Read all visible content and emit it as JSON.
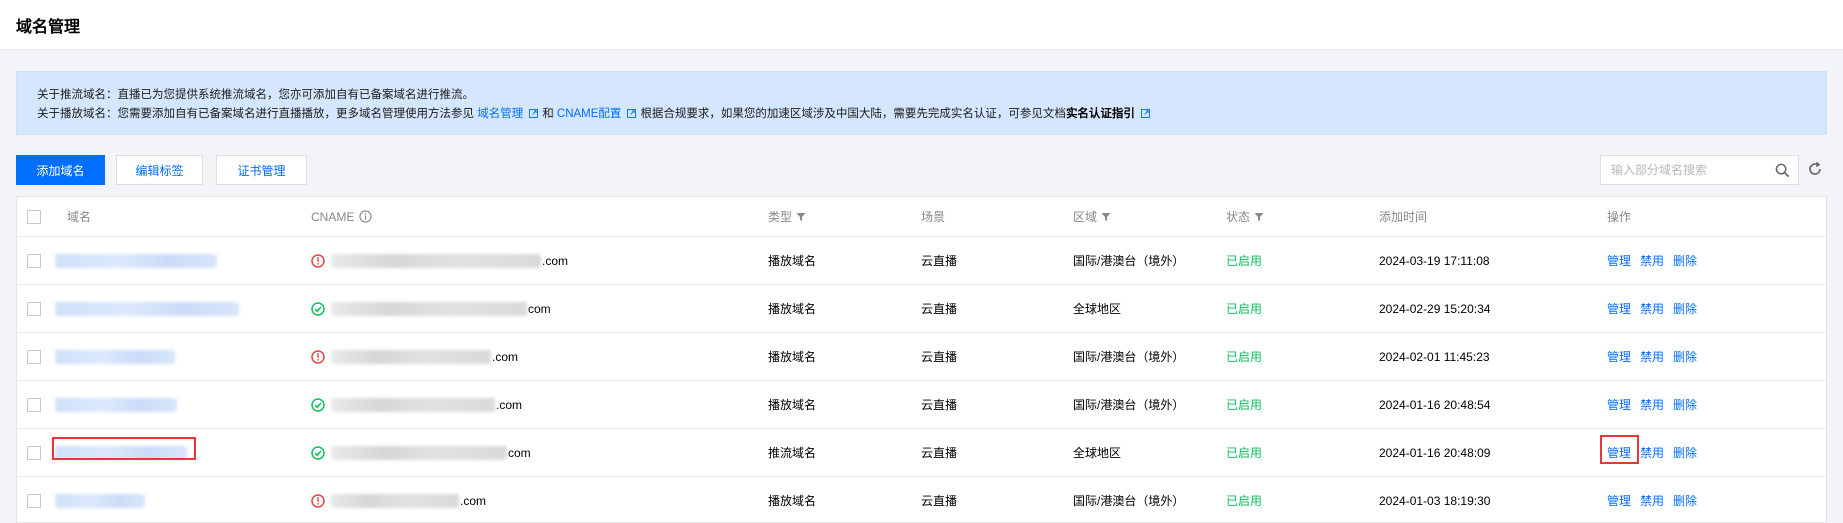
{
  "page": {
    "title": "域名管理"
  },
  "notice": {
    "line1": "关于推流域名：直播已为您提供系统推流域名，您亦可添加自有已备案域名进行推流。",
    "line2_prefix": "关于播放域名：您需要添加自有已备案域名进行直播播放，更多域名管理使用方法参见",
    "link_domain_mgmt": "域名管理",
    "and": "和",
    "link_cname": "CNAME配置",
    "line2_middle": "根据合规要求，如果您的加速区域涉及中国大陆，需要先完成实名认证，可参见文档",
    "link_realname": "实名认证指引"
  },
  "toolbar": {
    "add_domain": "添加域名",
    "edit_tags": "编辑标签",
    "cert_mgmt": "证书管理",
    "search_placeholder": "输入部分域名搜索"
  },
  "table": {
    "headers": {
      "domain": "域名",
      "cname": "CNAME",
      "type": "类型",
      "scene": "场景",
      "region": "区域",
      "status": "状态",
      "added": "添加时间",
      "ops": "操作"
    },
    "rows": [
      {
        "cname_status": "warning",
        "cname_suffix": ".com",
        "type": "播放域名",
        "scene": "云直播",
        "region": "国际/港澳台（境外）",
        "status": "已启用",
        "added": "2024-03-19 17:11:08",
        "op_manage": "管理",
        "op_disable": "禁用",
        "op_delete": "删除"
      },
      {
        "cname_status": "ok",
        "cname_suffix": "com",
        "type": "播放域名",
        "scene": "云直播",
        "region": "全球地区",
        "status": "已启用",
        "added": "2024-02-29 15:20:34",
        "op_manage": "管理",
        "op_disable": "禁用",
        "op_delete": "删除"
      },
      {
        "cname_status": "warning",
        "cname_suffix": ".com",
        "type": "播放域名",
        "scene": "云直播",
        "region": "国际/港澳台（境外）",
        "status": "已启用",
        "added": "2024-02-01 11:45:23",
        "op_manage": "管理",
        "op_disable": "禁用",
        "op_delete": "删除"
      },
      {
        "cname_status": "ok",
        "cname_suffix": ".com",
        "type": "播放域名",
        "scene": "云直播",
        "region": "国际/港澳台（境外）",
        "status": "已启用",
        "added": "2024-01-16 20:48:54",
        "op_manage": "管理",
        "op_disable": "禁用",
        "op_delete": "删除"
      },
      {
        "cname_status": "ok",
        "cname_suffix": "com",
        "type": "推流域名",
        "scene": "云直播",
        "region": "全球地区",
        "status": "已启用",
        "added": "2024-01-16 20:48:09",
        "op_manage": "管理",
        "op_disable": "禁用",
        "op_delete": "删除"
      },
      {
        "cname_status": "warning",
        "cname_suffix": ".com",
        "type": "播放域名",
        "scene": "云直播",
        "region": "国际/港澳台（境外）",
        "status": "已启用",
        "added": "2024-01-03 18:19:30",
        "op_manage": "管理",
        "op_disable": "禁用",
        "op_delete": "删除"
      }
    ]
  },
  "icons": {
    "warning_color": "#e54545",
    "ok_color": "#0abf5b",
    "link_color": "#006eff"
  }
}
